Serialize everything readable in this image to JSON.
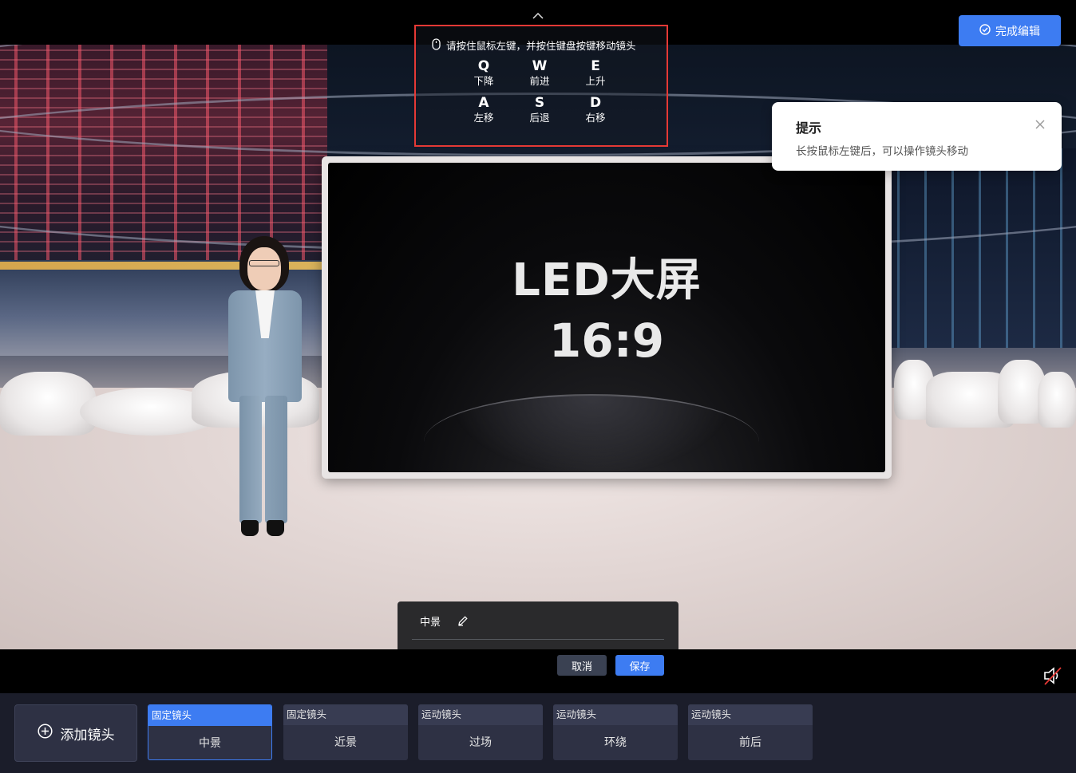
{
  "top_bar": {
    "done_button_label": "完成编辑"
  },
  "keyboard_guide": {
    "hint": "请按住鼠标左键，并按住键盘按键移动镜头",
    "keys": [
      {
        "letter": "Q",
        "label": "下降"
      },
      {
        "letter": "W",
        "label": "前进"
      },
      {
        "letter": "E",
        "label": "上升"
      },
      {
        "letter": "A",
        "label": "左移"
      },
      {
        "letter": "S",
        "label": "后退"
      },
      {
        "letter": "D",
        "label": "右移"
      }
    ]
  },
  "toast": {
    "title": "提示",
    "message": "长按鼠标左键后，可以操作镜头移动"
  },
  "led_screen": {
    "title": "LED大屏",
    "ratio": "16:9"
  },
  "camera_panel": {
    "name": "中景",
    "cancel_label": "取消",
    "save_label": "保存"
  },
  "bottom_bar": {
    "add_camera_label": "添加镜头",
    "cameras": [
      {
        "type": "固定镜头",
        "name": "中景",
        "active": true
      },
      {
        "type": "固定镜头",
        "name": "近景",
        "active": false
      },
      {
        "type": "运动镜头",
        "name": "过场",
        "active": false
      },
      {
        "type": "运动镜头",
        "name": "环绕",
        "active": false
      },
      {
        "type": "运动镜头",
        "name": "前后",
        "active": false
      }
    ]
  },
  "colors": {
    "accent": "#3d7cf2",
    "guide_border": "#e53935",
    "bottom_bg": "#1b1d2a"
  },
  "icons": {
    "mouse": "mouse-icon",
    "check": "check-circle-icon",
    "chevron_up": "chevron-up-icon",
    "close": "close-icon",
    "edit": "pencil-icon",
    "mute": "speaker-muted-icon",
    "add": "plus-circle-icon"
  }
}
